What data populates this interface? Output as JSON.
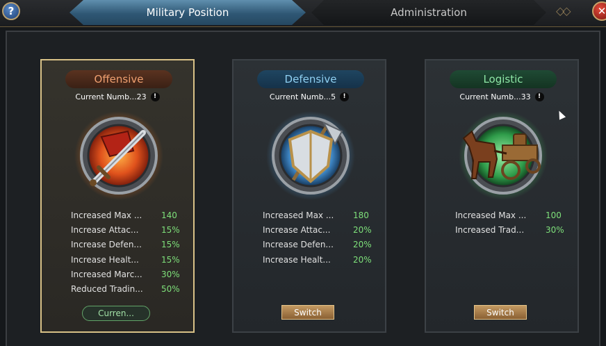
{
  "header": {
    "help_glyph": "?",
    "close_glyph": "✕",
    "deco_glyph": "◇◇",
    "tabs": [
      {
        "label": "Military Position",
        "active": true
      },
      {
        "label": "Administration",
        "active": false
      }
    ]
  },
  "colors": {
    "offensive": "#f0a070",
    "defensive": "#8fd0f2",
    "logistic": "#8ee6a6",
    "stat_value": "#7ee07a",
    "selected_border": "#d8c187"
  },
  "cards": [
    {
      "title": "Offensive",
      "count": "Current Numb...23",
      "info_glyph": "!",
      "emblem": "sword-emblem-icon",
      "selected": true,
      "stats": [
        {
          "label": "Increased Max ...",
          "value": "140"
        },
        {
          "label": "Increase Attac...",
          "value": "15%"
        },
        {
          "label": "Increase Defen...",
          "value": "15%"
        },
        {
          "label": "Increase Healt...",
          "value": "15%"
        },
        {
          "label": "Increased Marc...",
          "value": "30%"
        },
        {
          "label": "Reduced Tradin...",
          "value": "50%"
        }
      ],
      "button": "Curren..."
    },
    {
      "title": "Defensive",
      "count": "Current Numb...5",
      "info_glyph": "!",
      "emblem": "shield-emblem-icon",
      "selected": false,
      "stats": [
        {
          "label": "Increased Max ...",
          "value": "180"
        },
        {
          "label": "Increase Attac...",
          "value": "20%"
        },
        {
          "label": "Increase Defen...",
          "value": "20%"
        },
        {
          "label": "Increase Healt...",
          "value": "20%"
        }
      ],
      "button": "Switch"
    },
    {
      "title": "Logistic",
      "count": "Current Numb...33",
      "info_glyph": "!",
      "emblem": "horse-cart-emblem-icon",
      "selected": false,
      "stats": [
        {
          "label": "Increased Max ...",
          "value": "100"
        },
        {
          "label": "Increased Trad...",
          "value": "30%"
        }
      ],
      "button": "Switch"
    }
  ]
}
